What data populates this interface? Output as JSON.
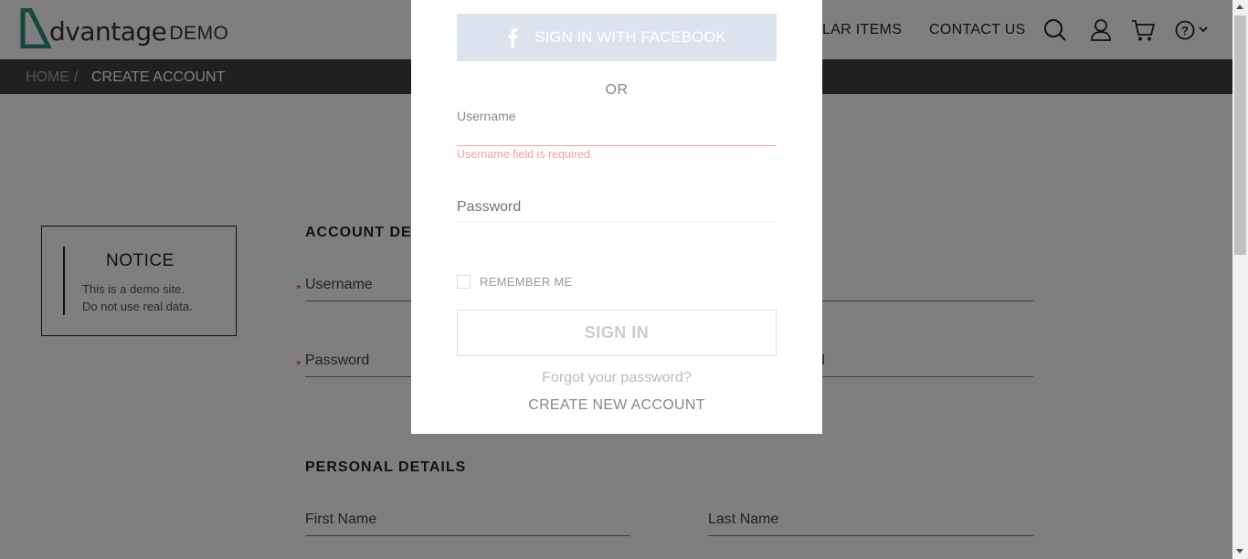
{
  "logo": {
    "word": "dvantage",
    "demo": "DEMO"
  },
  "nav": {
    "popular_items": "LAR ITEMS",
    "contact_us": "CONTACT US"
  },
  "breadcrumb": {
    "home": "HOME",
    "separator": "/",
    "current": "CREATE ACCOUNT"
  },
  "notice": {
    "title": "NOTICE",
    "line1": "This is a demo site.",
    "line2": "Do not use real data."
  },
  "form": {
    "account_details_title": "ACCOUNT DET",
    "username_label": "Username",
    "password_label": "Password",
    "confirm_password_tail": "d",
    "personal_details_title": "PERSONAL DETAILS",
    "first_name_label": "First Name",
    "last_name_label": "Last Name",
    "required_mark": "*"
  },
  "modal": {
    "facebook_button": "SIGN IN WITH FACEBOOK",
    "or": "OR",
    "username_label": "Username",
    "username_value": "",
    "username_error": "Username field is required.",
    "password_placeholder": "Password",
    "remember_me": "REMEMBER ME",
    "sign_in": "SIGN IN",
    "forgot_password": "Forgot your password?",
    "create_account": "CREATE NEW ACCOUNT"
  },
  "colors": {
    "accent": "#2d8c7d",
    "breadcrumb_bg": "#414141",
    "error": "#e23b4a"
  }
}
